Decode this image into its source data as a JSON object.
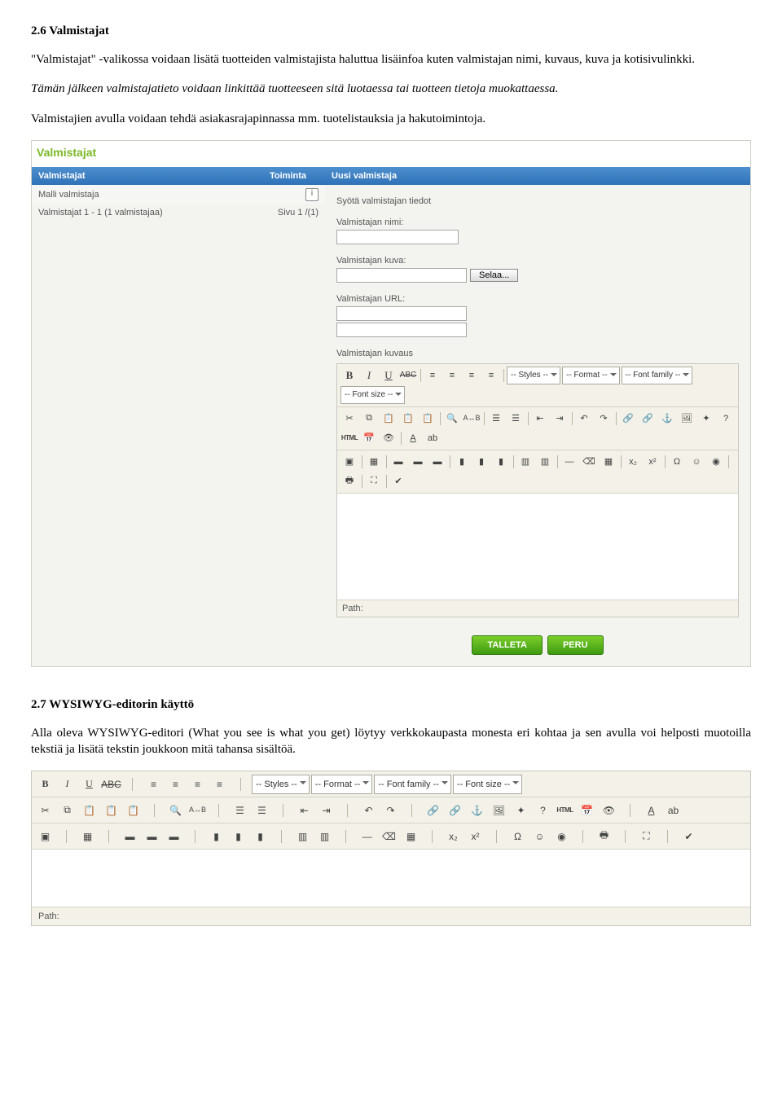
{
  "heading1": "2.6 Valmistajat",
  "para1": "\"Valmistajat\" -valikossa voidaan lisätä tuotteiden valmistajista haluttua lisäinfoa kuten valmistajan nimi, kuvaus, kuva ja kotisivulinkki.",
  "para2": "Tämän jälkeen valmistajatieto voidaan linkittää tuotteeseen sitä luotaessa tai tuotteen tietoja muokattaessa.",
  "para3": "Valmistajien avulla voidaan tehdä asiakasrajapinnassa mm. tuotelistauksia ja hakutoimintoja.",
  "panel": {
    "title": "Valmistajat",
    "left_header_main": "Valmistajat",
    "left_header_action": "Toiminta",
    "right_header": "Uusi valmistaja",
    "row_sample": "Malli valmistaja",
    "pager_text": "Valmistajat 1 - 1 (1 valmistajaa)",
    "pager_page": "Sivu 1 /(1)",
    "form_intro": "Syötä valmistajan tiedot",
    "lbl_name": "Valmistajan nimi:",
    "lbl_image": "Valmistajan kuva:",
    "browse": "Selaa...",
    "lbl_url": "Valmistajan URL:",
    "lbl_desc": "Valmistajan kuvaus",
    "path": "Path:",
    "save": "TALLETA",
    "cancel": "PERU"
  },
  "wys": {
    "styles": "-- Styles --",
    "format": "-- Format --",
    "font": "-- Font family --",
    "size": "-- Font size --",
    "html": "HTML"
  },
  "heading2": "2.7 WYSIWYG-editorin käyttö",
  "para4": "Alla oleva WYSIWYG-editori (What you see is what you get) löytyy verkkokaupasta monesta eri kohtaa ja sen avulla voi helposti muotoilla tekstiä ja lisätä tekstin joukkoon mitä tahansa sisältöä.",
  "pathlabel": "Path:"
}
